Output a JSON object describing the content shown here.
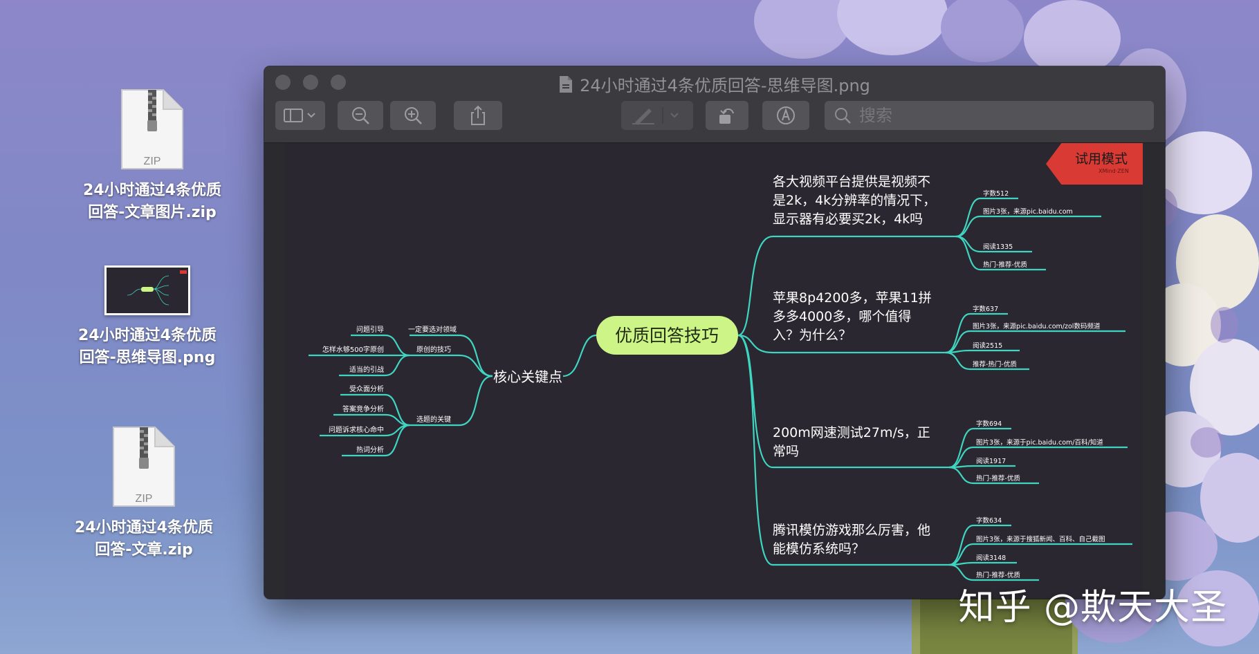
{
  "desktop": {
    "files": [
      {
        "name": "24小时通过4条优质\n回答-文章图片.zip",
        "kind": "ZIP"
      },
      {
        "name": "24小时通过4条优质\n回答-思维导图.png",
        "kind": "png"
      },
      {
        "name": "24小时通过4条优质\n回答-文章.zip",
        "kind": "ZIP"
      }
    ]
  },
  "window": {
    "title": "24小时通过4条优质回答-思维导图.png",
    "search_placeholder": "搜索"
  },
  "trial_badge": {
    "label": "试用模式",
    "sub": "XMind·ZEN"
  },
  "mindmap": {
    "central": "优质回答技巧",
    "left": {
      "label": "核心关键点",
      "groups": [
        {
          "label": "一定要选对领域",
          "items": []
        },
        {
          "label": "原创的技巧",
          "items": [
            "问题引导",
            "怎样水够500字原创",
            "适当的引战"
          ]
        },
        {
          "label": "选题的关键",
          "items": [
            "受众面分析",
            "答案竞争分析",
            "问题诉求核心命中",
            "热词分析"
          ]
        }
      ]
    },
    "right": [
      {
        "label": [
          "各大视频平台提供是视频不",
          "是2k，4k分辨率的情况下，",
          "显示器有必要买2k，4k吗"
        ],
        "items": [
          "字数512",
          "图片3张，来源pic.baidu.com",
          "阅读1335",
          "热门-推荐-优质"
        ]
      },
      {
        "label": [
          "苹果8p4200多，苹果11拼",
          "多多4000多，哪个值得",
          "入？为什么？"
        ],
        "items": [
          "字数637",
          "图片3张，来源pic.baidu.com/zol数码频道",
          "阅读2515",
          "推荐-热门-优质"
        ]
      },
      {
        "label": [
          "200m网速测试27m/s，正",
          "常吗"
        ],
        "items": [
          "字数694",
          "图片3张，来源于pic.baidu.com/百科/知道",
          "阅读1917",
          "热门-推荐-优质"
        ]
      },
      {
        "label": [
          "腾讯模仿游戏那么厉害，他",
          "能模仿系统吗？"
        ],
        "items": [
          "字数634",
          "图片3张，来源于搜狐新闻、百科、自己截图",
          "阅读3148",
          "热门-推荐-优质"
        ]
      }
    ]
  },
  "watermark": "知乎 @欺天大圣",
  "colors": {
    "line": "#3fd6c1",
    "central_fill": "#cdf487",
    "trial": "#d93a33",
    "canvas": "#2b2731"
  }
}
